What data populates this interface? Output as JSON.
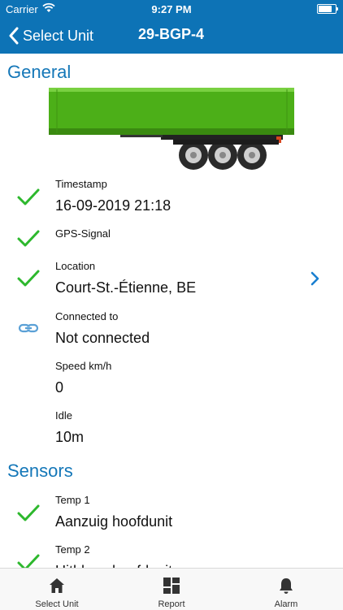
{
  "status_bar": {
    "carrier": "Carrier",
    "time": "9:27 PM",
    "battery_level": 0.9
  },
  "nav": {
    "back_label": "Select Unit",
    "title": "29-BGP-4"
  },
  "general": {
    "section_title": "General",
    "trailer_color": "#4caf18",
    "rows": [
      {
        "label": "Timestamp",
        "value": "16-09-2019 21:18",
        "icon": "check-icon"
      },
      {
        "label": "GPS-Signal",
        "value": "",
        "icon": "check-icon"
      },
      {
        "label": "Location",
        "value": "Court-St.-Étienne, BE",
        "icon": "check-icon"
      },
      {
        "label": "Connected to",
        "value": "Not connected",
        "icon": "link-icon"
      },
      {
        "label": "Speed km/h",
        "value": "0",
        "icon": ""
      },
      {
        "label": "Idle",
        "value": "10m",
        "icon": ""
      }
    ]
  },
  "sensors": {
    "section_title": "Sensors",
    "rows": [
      {
        "label": "Temp 1",
        "value": "Aanzuig hoofdunit",
        "icon": "check-icon"
      },
      {
        "label": "Temp 2",
        "value": "Uitblaas hoofdunit",
        "icon": "check-icon"
      }
    ]
  },
  "tabbar": {
    "tabs": [
      {
        "label": "Select Unit",
        "icon": "home-icon"
      },
      {
        "label": "Report",
        "icon": "dashboard-icon"
      },
      {
        "label": "Alarm",
        "icon": "bell-icon"
      }
    ]
  },
  "colors": {
    "accent": "#0d73b6",
    "section_title": "#1477b8",
    "check": "#2db82d",
    "link_icon": "#5aa0d6",
    "chevron": "#1a7fd0"
  }
}
